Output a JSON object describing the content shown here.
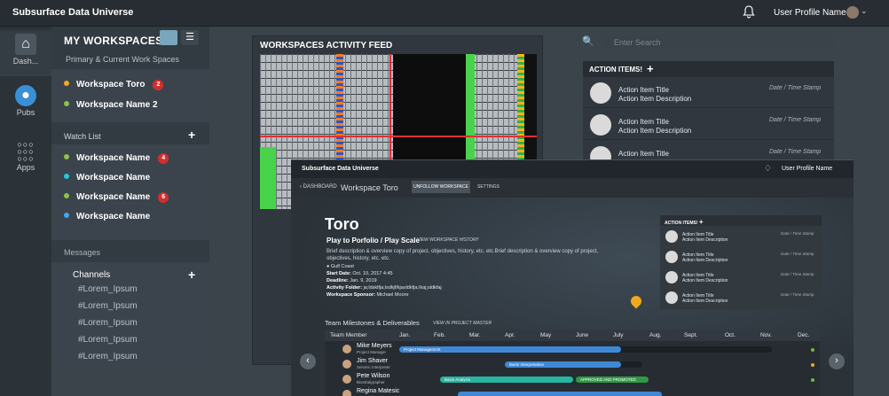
{
  "app": {
    "title": "Subsurface Data Universe",
    "profile_name": "User Profile Name"
  },
  "rail": [
    {
      "label": "Dash..."
    },
    {
      "label": "Pubs"
    },
    {
      "label": "Apps"
    }
  ],
  "workspaces": {
    "heading": "MY WORKSPACES",
    "subheading": "Primary & Current Work Spaces",
    "primary": [
      {
        "name": "Workspace Toro",
        "badge": "2",
        "pin_color": "#f5a623"
      },
      {
        "name": "Workspace Name 2",
        "badge": "",
        "pin_color": "#8bc34a"
      }
    ],
    "watch_list_label": "Watch List",
    "watch_list": [
      {
        "name": "Workspace Name",
        "badge": "4",
        "pin_color": "#8bc34a"
      },
      {
        "name": "Workspace Name",
        "badge": "",
        "pin_color": "#26c6da"
      },
      {
        "name": "Workspace Name",
        "badge": "6",
        "pin_color": "#8bc34a"
      },
      {
        "name": "Workspace Name",
        "badge": "",
        "pin_color": "#42a5f5"
      }
    ],
    "messages_label": "Messages",
    "channels_label": "Channels",
    "channels": [
      "#Lorem_Ipsum",
      "#Lorem_Ipsum",
      "#Lorem_Ipsum",
      "#Lorem_Ipsum",
      "#Lorem_Ipsum"
    ]
  },
  "feed": {
    "title": "WORKSPACES ACTIVITY FEED"
  },
  "search": {
    "placeholder": "Enter Search"
  },
  "actions": {
    "title": "ACTION ITEMS!",
    "items": [
      {
        "title": "Action Item Title",
        "desc": "Action Item Description",
        "ts": "Date / Time Stamp"
      },
      {
        "title": "Action Item Title",
        "desc": "Action Item Description",
        "ts": "Date / Time Stamp"
      },
      {
        "title": "Action Item Title",
        "desc": "",
        "ts": "Date / Time Stamp"
      }
    ]
  },
  "overlay": {
    "app_title": "Subsurface Data Universe",
    "profile_name": "User Profile Name",
    "back_label": "DASHBOARD",
    "workspace": "Workspace Toro",
    "unfollow": "UNFOLLOW WORKSPACE",
    "settings": "SETTINGS",
    "name": "Toro",
    "play": "Play to Porfolio / Play Scale",
    "history_link": "VIEW WORKSPACE HISTORY",
    "desc": "Brief description & overview copy of project, objectives, history, etc. etc.Brief description & overview copy of project, objectives, history, etc. etc.",
    "location": "Gulf Coast",
    "start_label": "Start Date:",
    "start": "Oct. 10, 2017 4:45",
    "deadline_label": "Deadline:",
    "deadline": "Jan. 9, 2019",
    "folder_label": "Activity Folder:",
    "folder": "ja;ldsklfja;lsdkjf/kjasldkfja;/kaj;sldkfaj",
    "sponsor_label": "Workspace Sponsor:",
    "sponsor": "Michael Moore",
    "actions_title": "ACTION ITEMS!",
    "actions": [
      {
        "title": "Action Item Title",
        "desc": "Action Item Description",
        "ts": "Date / Time Stamp"
      },
      {
        "title": "Action Item Title",
        "desc": "Action Item Description",
        "ts": "Date / Time Stamp"
      },
      {
        "title": "Action Item Title",
        "desc": "Action Item Description",
        "ts": "Date / Time Stamp"
      },
      {
        "title": "Action Item Title",
        "desc": "Action Item Description",
        "ts": "Date / Time Stamp"
      }
    ],
    "milestones_title": "Team Milestones & Deliverables",
    "milestones_link": "VIEW IN PROJECT MASTER",
    "columns": [
      "Team Member",
      "Jan.",
      "Feb.",
      "Mar.",
      "Apr.",
      "May",
      "June",
      "July",
      "Aug.",
      "Sept.",
      "Oct.",
      "Nov.",
      "Dec."
    ],
    "rows": [
      {
        "name": "Mike Meyers",
        "role": "Project Manager",
        "bar_label": "Project Management",
        "bar_color": "#3f88d6",
        "status_color": "#7cb342",
        "extra": ""
      },
      {
        "name": "Jim Shaver",
        "role": "Seismic Interpreter",
        "bar_label": "Basin Interpretation",
        "bar_color": "#3f88d6",
        "status_color": "#f5a623",
        "extra": ""
      },
      {
        "name": "Pete Wilson",
        "role": "Biostratigrapher",
        "bar_label": "Basin Analysis",
        "bar_color": "#26b5a0",
        "status_color": "#7cb342",
        "extra": "APPROVED AND PROMOTED"
      },
      {
        "name": "Regina Matesic",
        "role": "",
        "bar_label": "",
        "bar_color": "#3f88d6",
        "status_color": "#7cb342",
        "extra": ""
      }
    ]
  }
}
